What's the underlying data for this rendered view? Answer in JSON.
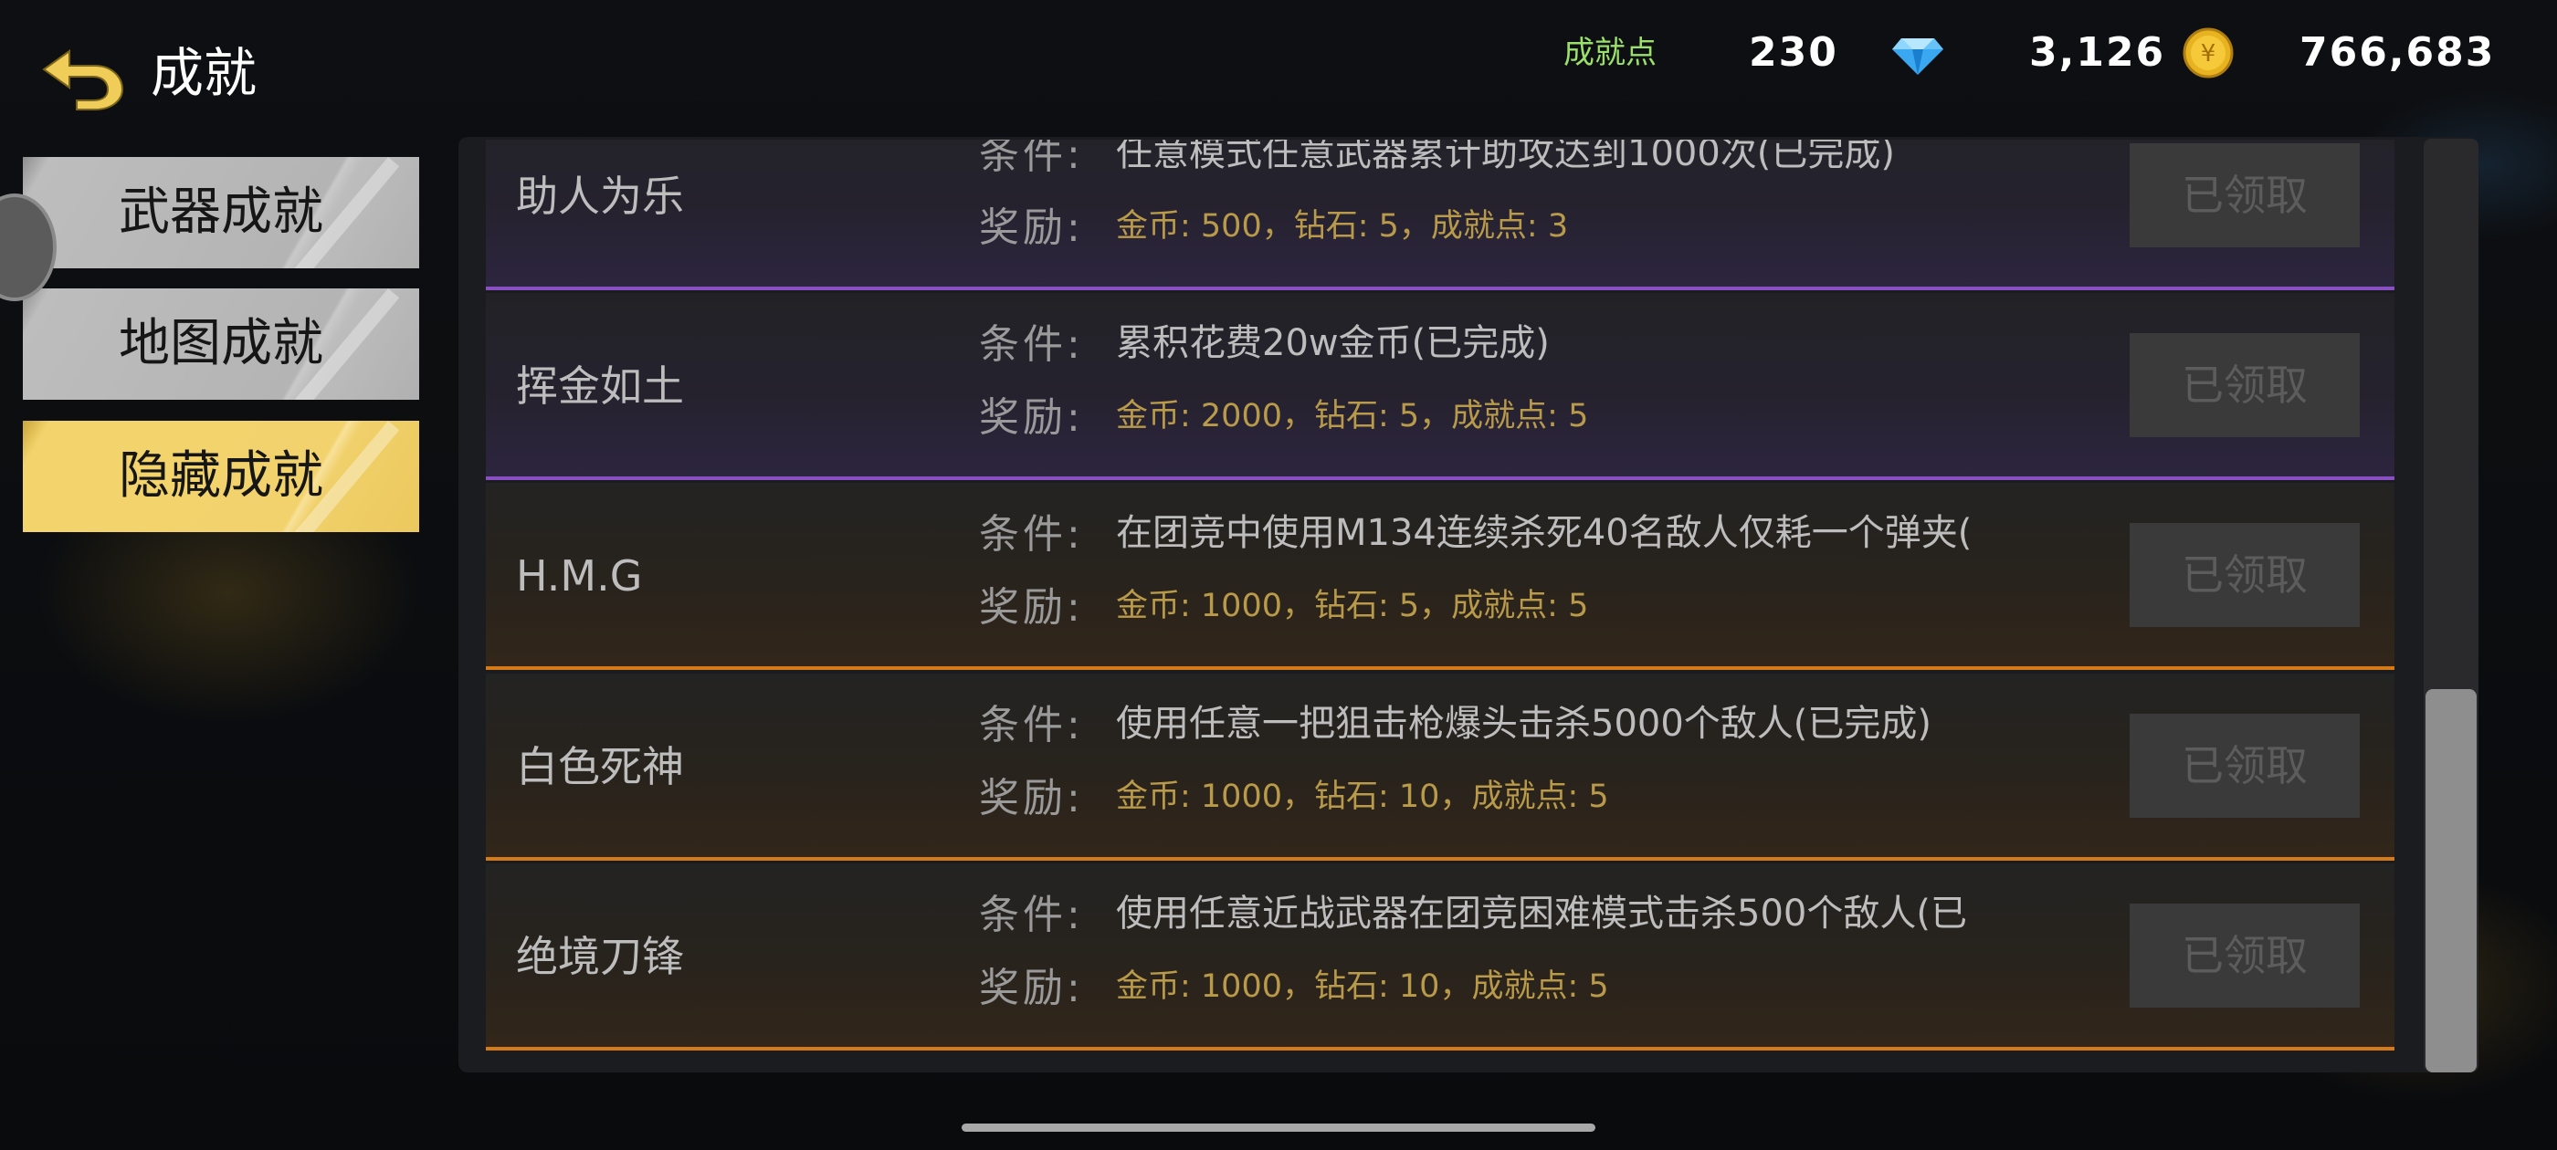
{
  "header": {
    "title": "成就",
    "achievement_points_label": "成就点",
    "achievement_points": "230",
    "diamonds": "3,126",
    "coins": "766,683",
    "coin_glyph": "¥"
  },
  "colors": {
    "active_tab": "#f2d26c",
    "inactive_tab": "#b4b4b4",
    "purple_line": "#8a4fc0",
    "orange_line": "#d67a18",
    "reward_text": "#b89a4a",
    "points_label": "#9be06a"
  },
  "tabs": [
    {
      "label": "武器成就",
      "active": false
    },
    {
      "label": "地图成就",
      "active": false
    },
    {
      "label": "隐藏成就",
      "active": true
    }
  ],
  "labels": {
    "condition": "条件:",
    "reward": "奖励:"
  },
  "achievements": [
    {
      "name": "助人为乐",
      "condition": "任意模式任意武器累计助攻达到1000次(已完成)",
      "reward": "金币: 500，钻石: 5，成就点: 3",
      "button": "已领取",
      "tier": "purple"
    },
    {
      "name": "挥金如土",
      "condition": "累积花费20w金币(已完成)",
      "reward": "金币: 2000，钻石: 5，成就点: 5",
      "button": "已领取",
      "tier": "purple"
    },
    {
      "name": "H.M.G",
      "condition": "在团竞中使用M134连续杀死40名敌人仅耗一个弹夹(",
      "reward": "金币: 1000，钻石: 5，成就点: 5",
      "button": "已领取",
      "tier": "orange"
    },
    {
      "name": "白色死神",
      "condition": "使用任意一把狙击枪爆头击杀5000个敌人(已完成)",
      "reward": "金币: 1000，钻石: 10，成就点: 5",
      "button": "已领取",
      "tier": "orange"
    },
    {
      "name": "绝境刀锋",
      "condition": "使用任意近战武器在团竞困难模式击杀500个敌人(已",
      "reward": "金币: 1000，钻石: 10，成就点: 5",
      "button": "已领取",
      "tier": "orange"
    }
  ]
}
